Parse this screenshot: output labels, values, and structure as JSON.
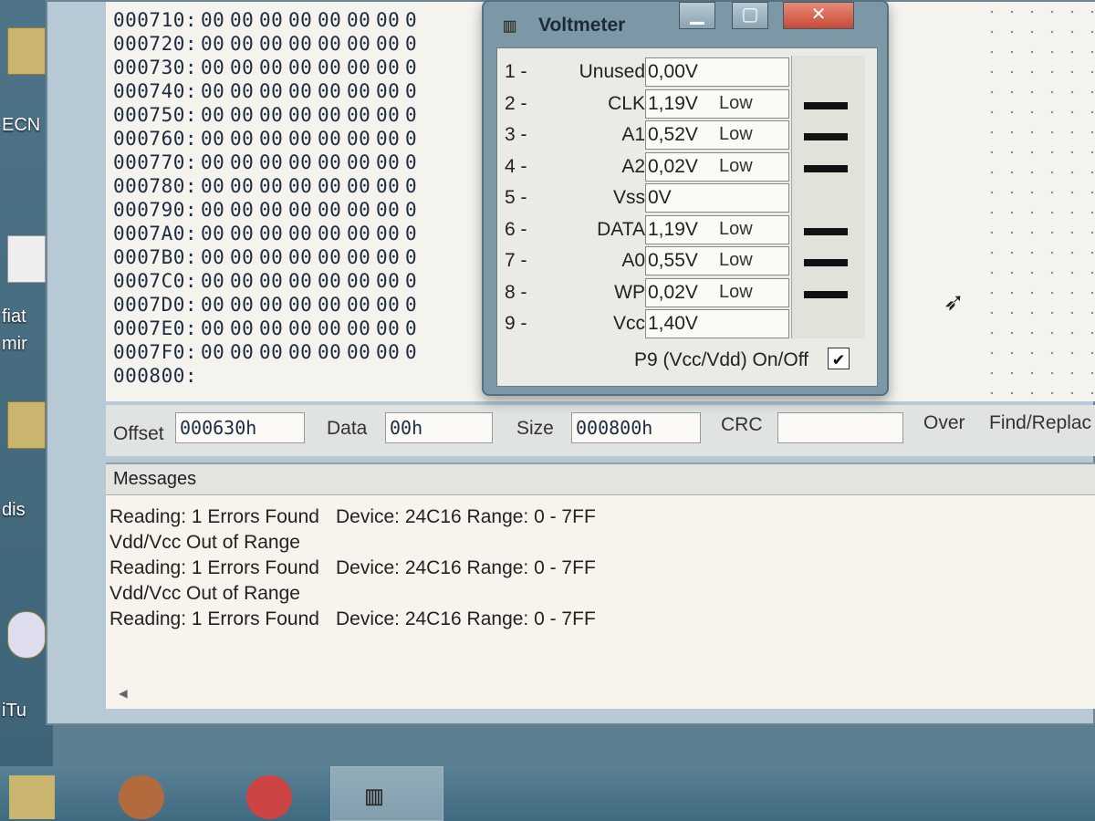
{
  "desktop": {
    "labels": [
      "ECN",
      "fiat",
      "mir",
      "dis",
      "iTu"
    ]
  },
  "hex_view": {
    "rows": [
      {
        "addr": "000710:",
        "bytes": [
          "00",
          "00",
          "00",
          "00",
          "00",
          "00",
          "00",
          "0"
        ]
      },
      {
        "addr": "000720:",
        "bytes": [
          "00",
          "00",
          "00",
          "00",
          "00",
          "00",
          "00",
          "0"
        ]
      },
      {
        "addr": "000730:",
        "bytes": [
          "00",
          "00",
          "00",
          "00",
          "00",
          "00",
          "00",
          "0"
        ]
      },
      {
        "addr": "000740:",
        "bytes": [
          "00",
          "00",
          "00",
          "00",
          "00",
          "00",
          "00",
          "0"
        ]
      },
      {
        "addr": "000750:",
        "bytes": [
          "00",
          "00",
          "00",
          "00",
          "00",
          "00",
          "00",
          "0"
        ]
      },
      {
        "addr": "000760:",
        "bytes": [
          "00",
          "00",
          "00",
          "00",
          "00",
          "00",
          "00",
          "0"
        ]
      },
      {
        "addr": "000770:",
        "bytes": [
          "00",
          "00",
          "00",
          "00",
          "00",
          "00",
          "00",
          "0"
        ]
      },
      {
        "addr": "000780:",
        "bytes": [
          "00",
          "00",
          "00",
          "00",
          "00",
          "00",
          "00",
          "0"
        ]
      },
      {
        "addr": "000790:",
        "bytes": [
          "00",
          "00",
          "00",
          "00",
          "00",
          "00",
          "00",
          "0"
        ]
      },
      {
        "addr": "0007A0:",
        "bytes": [
          "00",
          "00",
          "00",
          "00",
          "00",
          "00",
          "00",
          "0"
        ]
      },
      {
        "addr": "0007B0:",
        "bytes": [
          "00",
          "00",
          "00",
          "00",
          "00",
          "00",
          "00",
          "0"
        ]
      },
      {
        "addr": "0007C0:",
        "bytes": [
          "00",
          "00",
          "00",
          "00",
          "00",
          "00",
          "00",
          "0"
        ]
      },
      {
        "addr": "0007D0:",
        "bytes": [
          "00",
          "00",
          "00",
          "00",
          "00",
          "00",
          "00",
          "0"
        ]
      },
      {
        "addr": "0007E0:",
        "bytes": [
          "00",
          "00",
          "00",
          "00",
          "00",
          "00",
          "00",
          "0"
        ]
      },
      {
        "addr": "0007F0:",
        "bytes": [
          "00",
          "00",
          "00",
          "00",
          "00",
          "00",
          "00",
          "0"
        ]
      },
      {
        "addr": "000800:",
        "bytes": []
      }
    ]
  },
  "status_bar": {
    "offset_label": "Offset",
    "offset_value": "000630h",
    "data_label": "Data",
    "data_value": "00h",
    "size_label": "Size",
    "size_value": "000800h",
    "crc_label": "CRC",
    "crc_value": "",
    "over_label": "Over",
    "find_replace_label": "Find/Replac"
  },
  "messages": {
    "header": "Messages",
    "lines": [
      {
        "text": "Reading:  1 Errors Found",
        "detail": "Device: 24C16 Range: 0 - 7FF"
      },
      {
        "text": "Vdd/Vcc Out of Range",
        "detail": ""
      },
      {
        "text": "Reading:  1 Errors Found",
        "detail": "Device: 24C16 Range: 0 - 7FF"
      },
      {
        "text": "Vdd/Vcc Out of Range",
        "detail": ""
      },
      {
        "text": "Reading:  1 Errors Found",
        "detail": "Device: 24C16 Range: 0 - 7FF"
      }
    ]
  },
  "voltmeter": {
    "title": "Voltmeter",
    "pins": [
      {
        "num": "1 -",
        "name": "Unused",
        "value": "0,00V",
        "state": "",
        "bar": false
      },
      {
        "num": "2 -",
        "name": "CLK",
        "value": "1,19V",
        "state": "Low",
        "bar": true
      },
      {
        "num": "3 -",
        "name": "A1",
        "value": "0,52V",
        "state": "Low",
        "bar": true
      },
      {
        "num": "4 -",
        "name": "A2",
        "value": "0,02V",
        "state": "Low",
        "bar": true
      },
      {
        "num": "5 -",
        "name": "Vss",
        "value": "0V",
        "state": "",
        "bar": false
      },
      {
        "num": "6 -",
        "name": "DATA",
        "value": "1,19V",
        "state": "Low",
        "bar": true
      },
      {
        "num": "7 -",
        "name": "A0",
        "value": "0,55V",
        "state": "Low",
        "bar": true
      },
      {
        "num": "8 -",
        "name": "WP",
        "value": "0,02V",
        "state": "Low",
        "bar": true
      },
      {
        "num": "9 -",
        "name": "Vcc",
        "value": "1,40V",
        "state": "",
        "bar": false
      }
    ],
    "toggle_label": "P9 (Vcc/Vdd) On/Off",
    "toggle_checked": true
  }
}
